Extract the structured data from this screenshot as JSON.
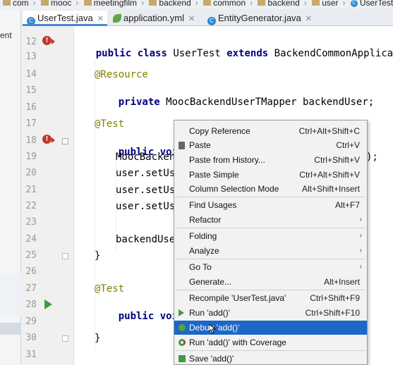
{
  "breadcrumb": [
    {
      "label": "com",
      "icon": "folder-icon"
    },
    {
      "label": "mooc",
      "icon": "folder-icon"
    },
    {
      "label": "meetingfilm",
      "icon": "folder-icon"
    },
    {
      "label": "backend",
      "icon": "folder-icon"
    },
    {
      "label": "common",
      "icon": "folder-icon"
    },
    {
      "label": "backend",
      "icon": "folder-icon"
    },
    {
      "label": "user",
      "icon": "folder-icon"
    },
    {
      "label": "UserTest",
      "icon": "class-icon"
    }
  ],
  "tabs": [
    {
      "label": "UserTest.java",
      "icon": "class-icon",
      "active": true
    },
    {
      "label": "application.yml",
      "icon": "yaml-leaf-icon",
      "active": false
    },
    {
      "label": "EntityGenerator.java",
      "icon": "class-icon",
      "active": false
    }
  ],
  "left_pane": {
    "fragment": "ent"
  },
  "editor": {
    "lines": [
      {
        "no": "12",
        "text": "public class UserTest extends BackendCommonApplicationTests"
      },
      {
        "no": "13",
        "text": ""
      },
      {
        "no": "14",
        "text": "@Resource"
      },
      {
        "no": "15",
        "text": "private MoocBackendUserTMapper backendUser;"
      },
      {
        "no": "16",
        "text": ""
      },
      {
        "no": "17",
        "text": "@Test"
      },
      {
        "no": "18",
        "text": "public void ad"
      },
      {
        "no": "19",
        "text": "MoocBackend"
      },
      {
        "no": "20",
        "text": "user.setUse"
      },
      {
        "no": "21",
        "text": "user.setUse"
      },
      {
        "no": "22",
        "text": "user.setUse"
      },
      {
        "no": "23",
        "text": ""
      },
      {
        "no": "24",
        "text": "backendUse"
      },
      {
        "no": "25",
        "text": "}"
      },
      {
        "no": "26",
        "text": ""
      },
      {
        "no": "27",
        "text": "@Test"
      },
      {
        "no": "28",
        "text": "public void se"
      },
      {
        "no": "29",
        "text": ""
      },
      {
        "no": "30",
        "text": "}"
      },
      {
        "no": "31",
        "text": ""
      }
    ],
    "line19_tail": ");"
  },
  "context_menu": {
    "items": [
      {
        "label": "Copy Reference",
        "shortcut": "Ctrl+Alt+Shift+C"
      },
      {
        "label": "Paste",
        "shortcut": "Ctrl+V",
        "icon": "clipboard-icon"
      },
      {
        "label": "Paste from History...",
        "shortcut": "Ctrl+Shift+V"
      },
      {
        "label": "Paste Simple",
        "shortcut": "Ctrl+Alt+Shift+V"
      },
      {
        "label": "Column Selection Mode",
        "shortcut": "Alt+Shift+Insert"
      },
      {
        "label": "Find Usages",
        "shortcut": "Alt+F7"
      },
      {
        "label": "Refactor",
        "submenu": true
      },
      {
        "label": "Folding",
        "submenu": true
      },
      {
        "label": "Analyze",
        "submenu": true
      },
      {
        "label": "Go To",
        "submenu": true
      },
      {
        "label": "Generate...",
        "shortcut": "Alt+Insert"
      },
      {
        "label": "Recompile 'UserTest.java'",
        "shortcut": "Ctrl+Shift+F9"
      },
      {
        "label": "Run 'add()'",
        "shortcut": "Ctrl+Shift+F10",
        "icon": "run-icon"
      },
      {
        "label": "Debug 'add()'",
        "icon": "debug-icon",
        "highlighted": true
      },
      {
        "label": "Run 'add()' with Coverage",
        "icon": "coverage-icon"
      },
      {
        "label": "Save 'add()'",
        "icon": "save-icon"
      }
    ],
    "submenu_glyph": "›"
  },
  "colors": {
    "keyword": "#000080",
    "annotation": "#808000",
    "menu_highlight": "#1d67c7",
    "run_green": "#3d9c41",
    "override_red": "#c0392b",
    "tab_underline": "#4a88d6"
  }
}
